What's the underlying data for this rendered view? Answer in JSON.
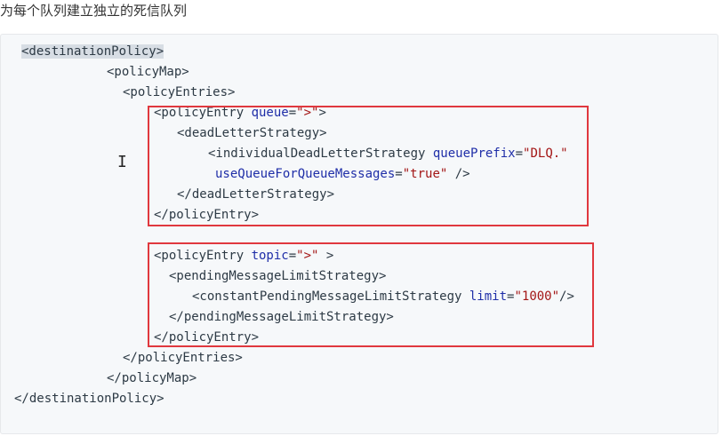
{
  "heading": "为每个队列建立独立的死信队列",
  "code": {
    "l1": {
      "tag": "<destinationPolicy>"
    },
    "l2": {
      "tag": "<policyMap>"
    },
    "l3": {
      "tag": "<policyEntries>"
    },
    "l4": {
      "open": "<policyEntry ",
      "attr": "queue",
      "eq": "=",
      "val": "\">\"",
      "close": ">"
    },
    "l5": {
      "tag": "<deadLetterStrategy>"
    },
    "l6": {
      "open": "<individualDeadLetterStrategy ",
      "attr": "queuePrefix",
      "eq": "=",
      "val": "\"DLQ.\""
    },
    "l7": {
      "attr": "useQueueForQueueMessages",
      "eq": "=",
      "val": "\"true\"",
      "close": " />"
    },
    "l8": {
      "tag": "</deadLetterStrategy>"
    },
    "l9": {
      "tag": "</policyEntry>"
    },
    "l10": {
      "open": "<policyEntry ",
      "attr": "topic",
      "eq": "=",
      "val": "\">\"",
      "close": " >"
    },
    "l11": {
      "tag": "<pendingMessageLimitStrategy>"
    },
    "l12": {
      "open": "<constantPendingMessageLimitStrategy ",
      "attr": "limit",
      "eq": "=",
      "val": "\"1000\"",
      "close": "/>"
    },
    "l13": {
      "tag": "</pendingMessageLimitStrategy>"
    },
    "l14": {
      "tag": "</policyEntry>"
    },
    "l15": {
      "tag": "</policyEntries>"
    },
    "l16": {
      "tag": "</policyMap>"
    },
    "l17": {
      "tag": "</destinationPolicy>"
    }
  },
  "cursor_icon": "text-cursor-icon",
  "colors": {
    "highlight_box": "#e0383e",
    "attr": "#1f2ea8",
    "string": "#a31515",
    "code_bg": "#f6f8fa"
  }
}
